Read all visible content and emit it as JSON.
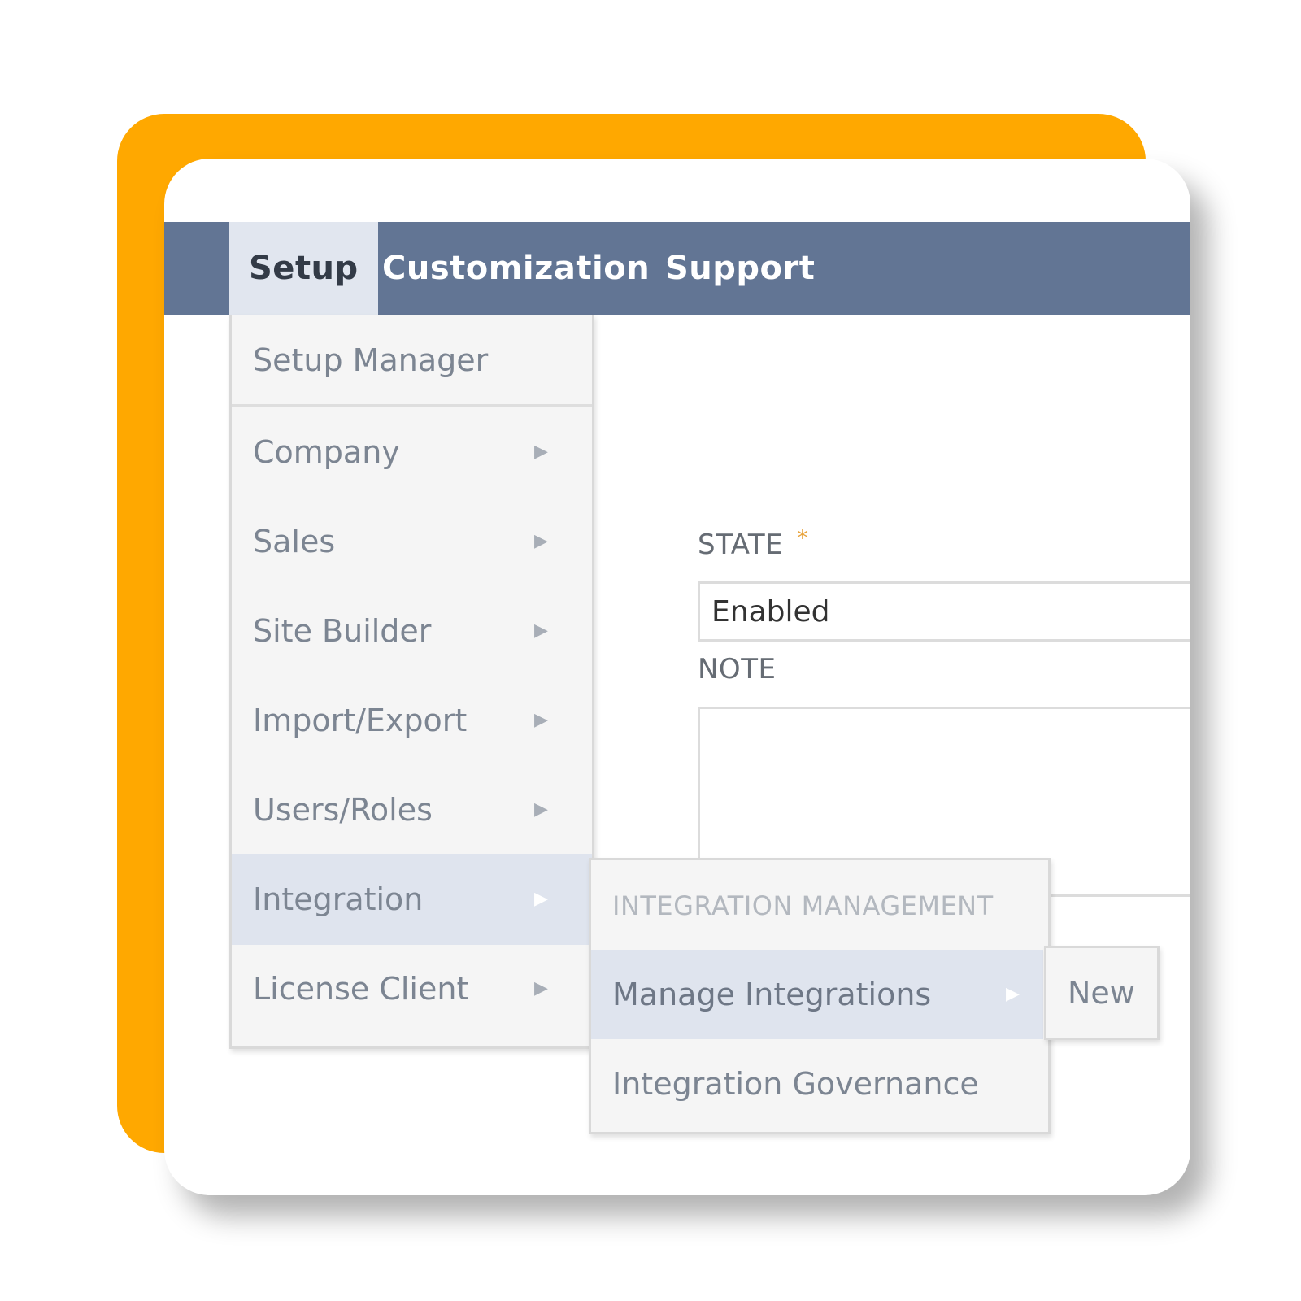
{
  "theme": {
    "accent_color": "#ffa800",
    "navbar_color": "#627594"
  },
  "navbar": {
    "tabs": [
      {
        "label": "Setup",
        "active": true
      },
      {
        "label": "Customization",
        "active": false
      },
      {
        "label": "Support",
        "active": false
      }
    ]
  },
  "setup_menu": {
    "top_item": "Setup Manager",
    "items": [
      {
        "label": "Company",
        "arrow": "▶"
      },
      {
        "label": "Sales",
        "arrow": "▶"
      },
      {
        "label": "Site Builder",
        "arrow": "▶"
      },
      {
        "label": "Import/Export",
        "arrow": "▶"
      },
      {
        "label": "Users/Roles",
        "arrow": "▶"
      },
      {
        "label": "Integration",
        "arrow": "▶",
        "highlighted": true
      },
      {
        "label": "License Client",
        "arrow": "▶"
      }
    ]
  },
  "integration_submenu": {
    "header": "INTEGRATION MANAGEMENT",
    "items": [
      {
        "label": "Manage Integrations",
        "arrow": "▶",
        "highlighted": true
      },
      {
        "label": "Integration Governance"
      }
    ]
  },
  "manage_flyout": {
    "items": [
      "New"
    ]
  },
  "form": {
    "state_label": "STATE",
    "state_required_mark": "*",
    "state_required_color": "#e8a23a",
    "state_value": "Enabled",
    "note_label": "NOTE",
    "note_value": ""
  }
}
